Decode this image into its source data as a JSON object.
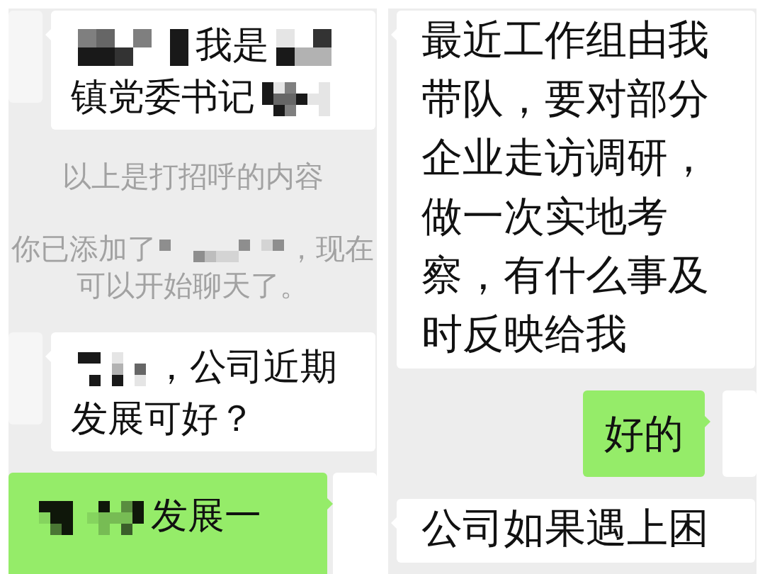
{
  "chat_panels": [
    {
      "messages": [
        {
          "kind": "incoming",
          "parts": [
            {
              "kind": "redacted"
            },
            {
              "kind": "text",
              "text": "我是"
            },
            {
              "kind": "redacted"
            },
            {
              "kind": "text",
              "text": "镇党委书记"
            },
            {
              "kind": "redacted"
            }
          ]
        },
        {
          "kind": "notice",
          "parts": [
            {
              "kind": "text",
              "text": "以上是打招呼的内容"
            }
          ]
        },
        {
          "kind": "notice",
          "parts": [
            {
              "kind": "text",
              "text": "你已添加了"
            },
            {
              "kind": "redacted"
            },
            {
              "kind": "text",
              "text": "，现在"
            },
            {
              "kind": "text",
              "text": "可以开始聊天了。"
            }
          ]
        },
        {
          "kind": "incoming",
          "parts": [
            {
              "kind": "redacted"
            },
            {
              "kind": "text",
              "text": "，公司近期"
            },
            {
              "kind": "text",
              "text": "发展可好？"
            }
          ]
        },
        {
          "kind": "outgoing",
          "parts": [
            {
              "kind": "redacted"
            },
            {
              "kind": "redacted"
            },
            {
              "kind": "text",
              "text": "发展一"
            }
          ]
        }
      ]
    },
    {
      "messages": [
        {
          "kind": "incoming",
          "parts": [
            {
              "kind": "text",
              "text": "最近工作组由我带队，要对部分企业走访调研，做一次实地考察，有什么事及时反映给我"
            }
          ]
        },
        {
          "kind": "outgoing",
          "parts": [
            {
              "kind": "text",
              "text": "好的"
            }
          ]
        },
        {
          "kind": "incoming",
          "parts": [
            {
              "kind": "text",
              "text": "公司如果遇上困"
            }
          ]
        }
      ]
    }
  ]
}
